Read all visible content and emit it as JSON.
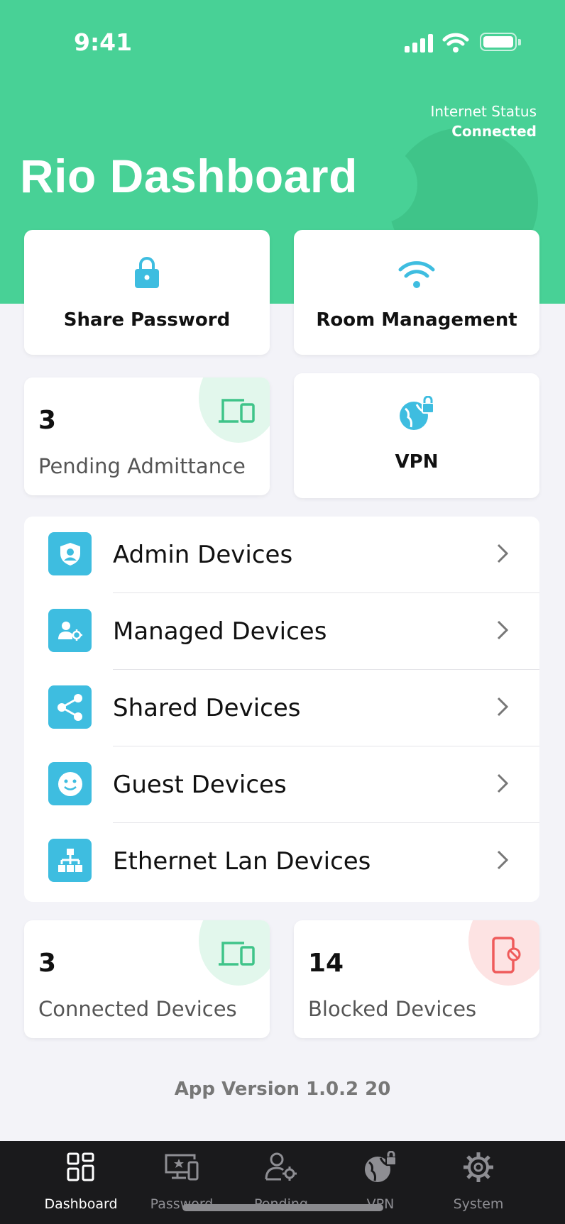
{
  "status_bar": {
    "time": "9:41"
  },
  "header": {
    "title": "Rio Dashboard",
    "internet_status_label": "Internet Status",
    "internet_status_value": "Connected"
  },
  "quick_actions": {
    "share_password": {
      "label": "Share Password",
      "icon": "lock-icon"
    },
    "room_management": {
      "label": "Room Management",
      "icon": "wifi-icon"
    },
    "vpn": {
      "label": "VPN",
      "icon": "globe-lock-icon"
    }
  },
  "stats": {
    "pending": {
      "value": "3",
      "label": "Pending Admittance",
      "icon": "devices-icon",
      "color": "#e2f7ec"
    },
    "connected": {
      "value": "3",
      "label": "Connected Devices",
      "icon": "devices-icon",
      "color": "#e2f7ec"
    },
    "blocked": {
      "value": "14",
      "label": "Blocked Devices",
      "icon": "blocked-phone-icon",
      "color": "#fde3e3"
    }
  },
  "device_list": [
    {
      "label": "Admin Devices",
      "icon": "shield-user-icon"
    },
    {
      "label": "Managed Devices",
      "icon": "user-gear-icon"
    },
    {
      "label": "Shared Devices",
      "icon": "share-icon"
    },
    {
      "label": "Guest Devices",
      "icon": "smiley-icon"
    },
    {
      "label": "Ethernet Lan Devices",
      "icon": "network-icon"
    }
  ],
  "app_version": "App Version 1.0.2 20",
  "tabbar": {
    "items": [
      {
        "label": "Dashboard",
        "icon": "grid-icon",
        "active": true
      },
      {
        "label": "Password",
        "icon": "monitor-star-icon",
        "active": false
      },
      {
        "label": "Pending",
        "icon": "user-gear-icon",
        "active": false
      },
      {
        "label": "VPN",
        "icon": "globe-lock-icon",
        "active": false
      },
      {
        "label": "System",
        "icon": "gear-icon",
        "active": false
      }
    ]
  },
  "colors": {
    "brand_green": "#48d196",
    "accent_blue": "#3ebde0",
    "icon_green": "#3fc489",
    "icon_red": "#ef5b5b"
  }
}
